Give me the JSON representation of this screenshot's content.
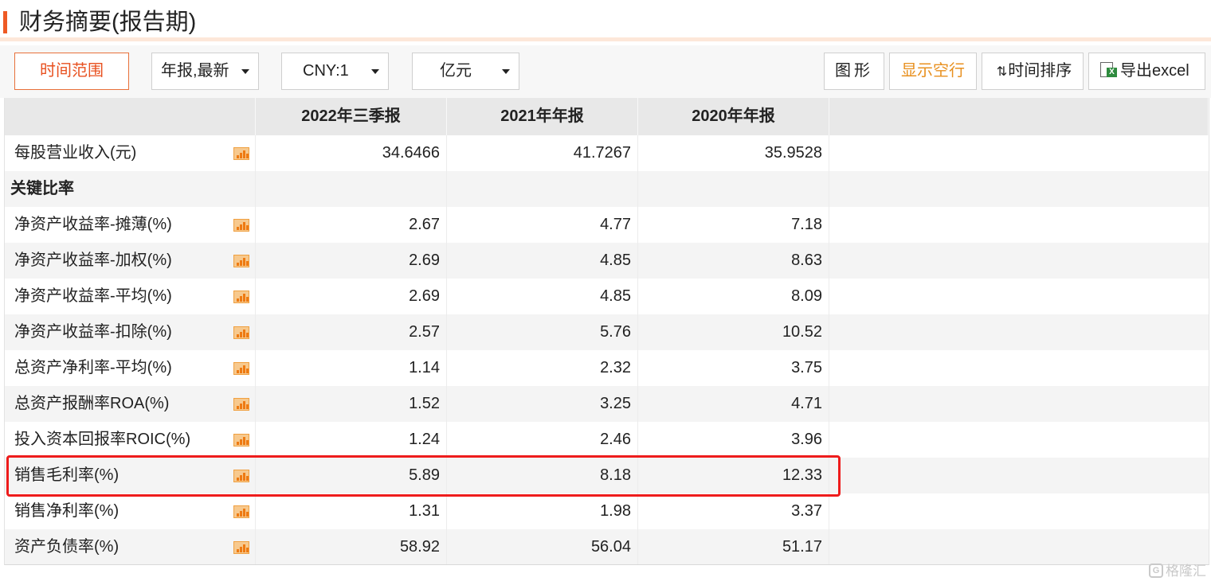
{
  "title": "财务摘要(报告期)",
  "toolbar": {
    "time_range_label": "时间范围",
    "report_type_value": "年报,最新",
    "currency_value": "CNY:1",
    "unit_value": "亿元",
    "chart_label": "图形",
    "show_blank_label": "显示空行",
    "sort_label": "时间排序",
    "export_label": "导出excel",
    "accent_color": "#e8501f"
  },
  "table": {
    "columns": [
      "2022年三季报",
      "2021年年报",
      "2020年年报"
    ],
    "rows": [
      {
        "name": "每股营业收入(元)",
        "values": [
          "34.6466",
          "41.7267",
          "35.9528"
        ],
        "chart_icon": true
      },
      {
        "name": "关键比率",
        "values": [
          "",
          "",
          ""
        ],
        "section": true
      },
      {
        "name": "净资产收益率-摊薄(%)",
        "values": [
          "2.67",
          "4.77",
          "7.18"
        ],
        "chart_icon": true
      },
      {
        "name": "净资产收益率-加权(%)",
        "values": [
          "2.69",
          "4.85",
          "8.63"
        ],
        "chart_icon": true
      },
      {
        "name": "净资产收益率-平均(%)",
        "values": [
          "2.69",
          "4.85",
          "8.09"
        ],
        "chart_icon": true
      },
      {
        "name": "净资产收益率-扣除(%)",
        "values": [
          "2.57",
          "5.76",
          "10.52"
        ],
        "chart_icon": true
      },
      {
        "name": "总资产净利率-平均(%)",
        "values": [
          "1.14",
          "2.32",
          "3.75"
        ],
        "chart_icon": true
      },
      {
        "name": "总资产报酬率ROA(%)",
        "values": [
          "1.52",
          "3.25",
          "4.71"
        ],
        "chart_icon": true
      },
      {
        "name": "投入资本回报率ROIC(%)",
        "values": [
          "1.24",
          "2.46",
          "3.96"
        ],
        "chart_icon": true
      },
      {
        "name": "销售毛利率(%)",
        "values": [
          "5.89",
          "8.18",
          "12.33"
        ],
        "chart_icon": true,
        "highlighted": true
      },
      {
        "name": "销售净利率(%)",
        "values": [
          "1.31",
          "1.98",
          "3.37"
        ],
        "chart_icon": true
      },
      {
        "name": "资产负债率(%)",
        "values": [
          "58.92",
          "56.04",
          "51.17"
        ],
        "chart_icon": true
      }
    ],
    "highlight_color": "#ee1c1c"
  },
  "watermark": {
    "text": "格隆汇",
    "icon": "gelonghui-logo-icon"
  }
}
